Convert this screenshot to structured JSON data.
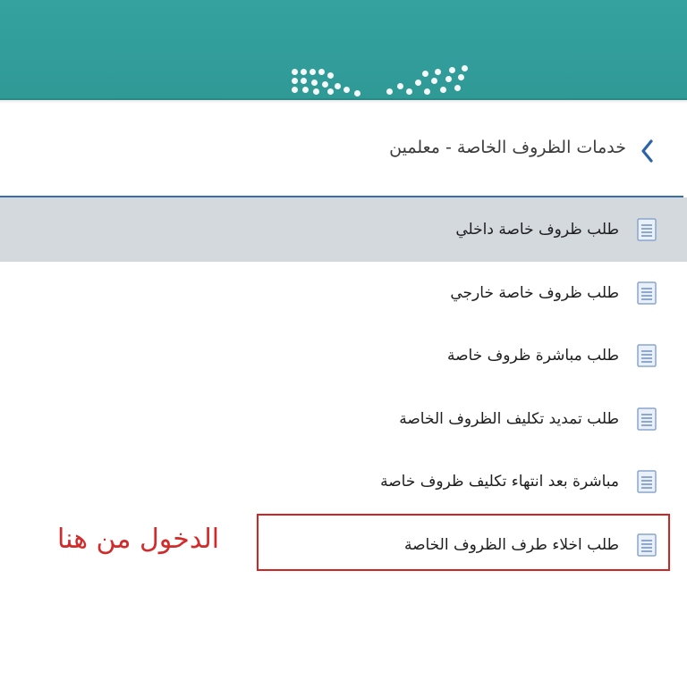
{
  "header": {
    "bg_color": "#33a09e",
    "logo_icon": "ministry-logo-dots"
  },
  "title_row": {
    "back_icon": "chevron-left-icon",
    "title": "خدمات الظروف الخاصة - معلمين"
  },
  "menu": {
    "items": [
      {
        "label": "طلب ظروف خاصة داخلي",
        "icon": "document-icon",
        "selected": true
      },
      {
        "label": "طلب ظروف خاصة خارجي",
        "icon": "document-icon",
        "selected": false
      },
      {
        "label": "طلب مباشرة ظروف خاصة",
        "icon": "document-icon",
        "selected": false
      },
      {
        "label": "طلب تمديد تكليف الظروف الخاصة",
        "icon": "document-icon",
        "selected": false
      },
      {
        "label": "مباشرة بعد انتهاء تكليف ظروف خاصة",
        "icon": "document-icon",
        "selected": false
      },
      {
        "label": "طلب اخلاء طرف الظروف الخاصة",
        "icon": "document-icon",
        "selected": false
      }
    ]
  },
  "annotation": {
    "text": "الدخول من هنا",
    "color": "#d12b2b"
  },
  "colors": {
    "accent": "#3a6ea5",
    "selected_row": "#d4d9de",
    "highlight": "#d32424"
  }
}
